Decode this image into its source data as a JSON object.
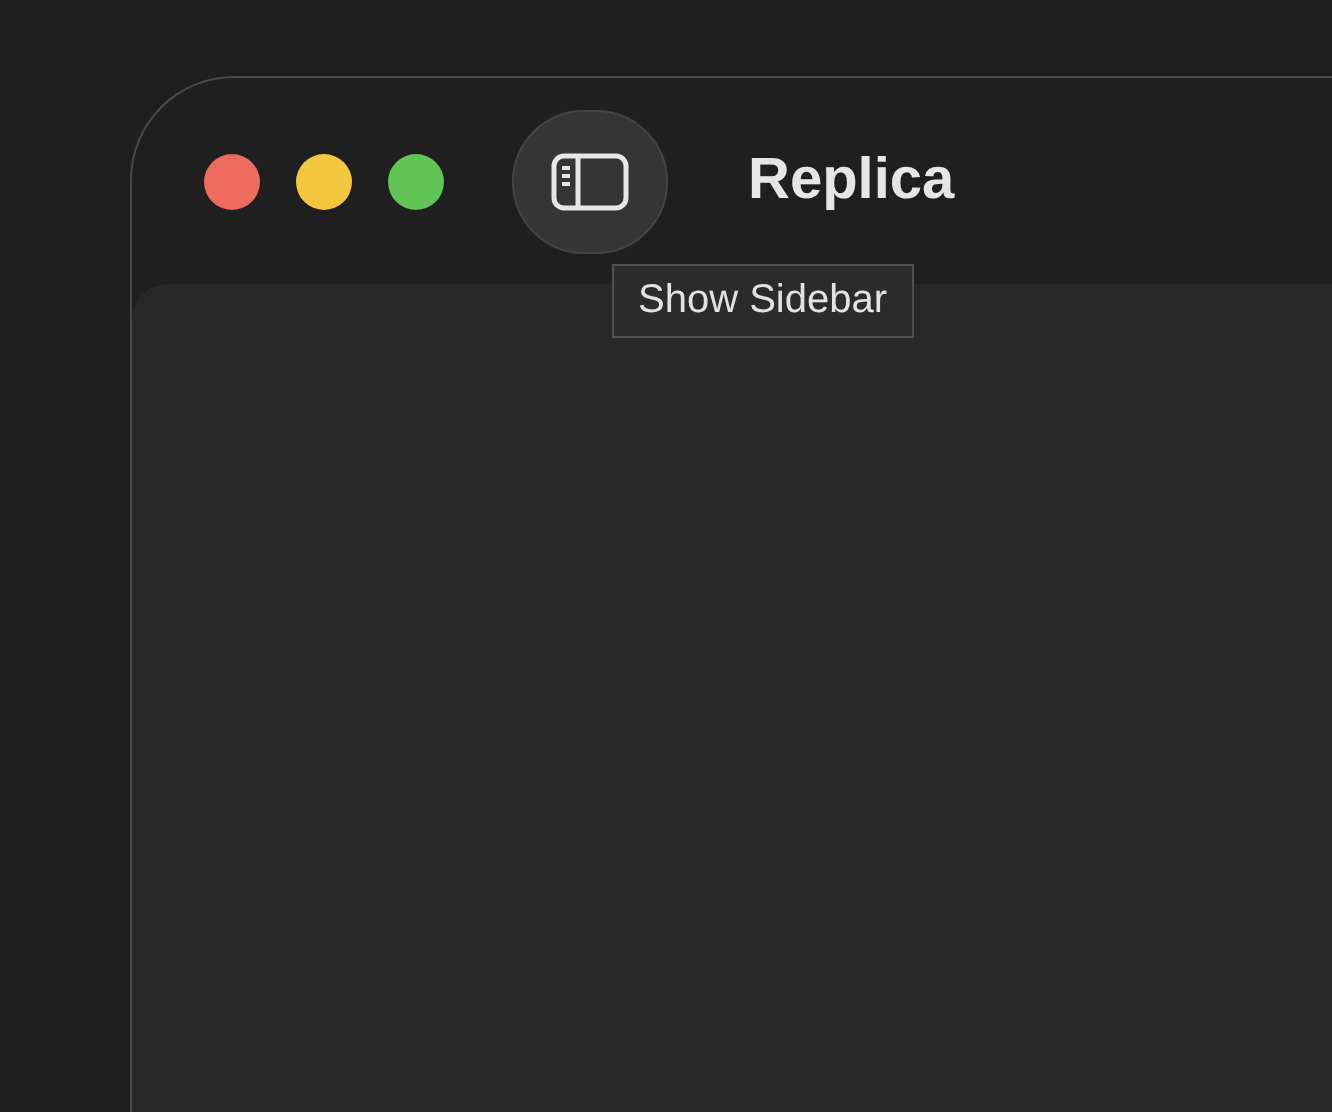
{
  "window": {
    "title": "Replica"
  },
  "sidebar_button": {
    "tooltip": "Show Sidebar"
  }
}
